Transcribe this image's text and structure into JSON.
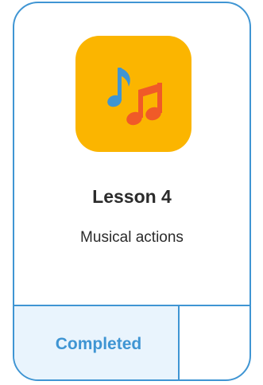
{
  "lesson": {
    "title": "Lesson 4",
    "subtitle": "Musical actions",
    "icon": "music-notes-icon",
    "status": "Completed"
  },
  "colors": {
    "border": "#3f95d3",
    "icon_background": "#fbb500",
    "note_blue": "#3f95d3",
    "note_orange": "#f05a28",
    "status_background": "#e9f4fd"
  }
}
